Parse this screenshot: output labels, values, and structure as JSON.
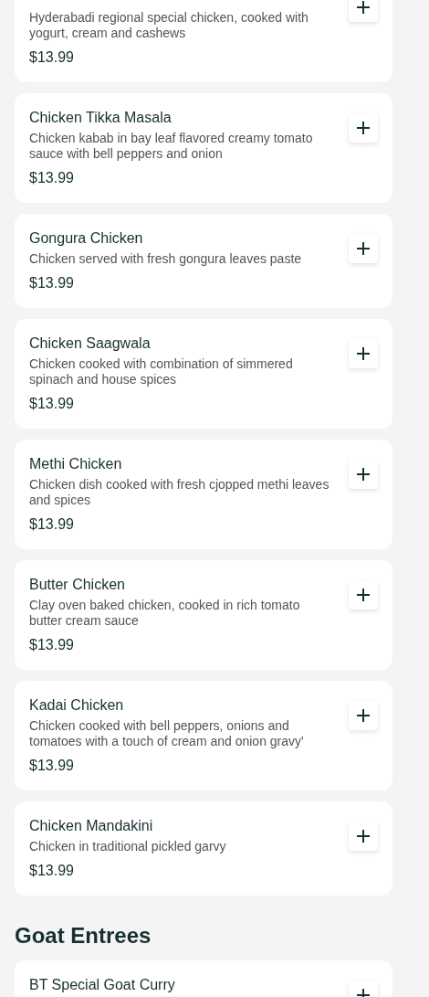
{
  "sections": [
    {
      "items": [
        {
          "description": "Hyderabadi regional special chicken, cooked with yogurt, cream and cashews",
          "price": "$13.99"
        },
        {
          "name": "Chicken Tikka Masala",
          "description": "Chicken kabab in bay leaf flavored creamy tomato sauce with bell peppers and onion",
          "price": "$13.99"
        },
        {
          "name": "Gongura Chicken",
          "description": "Chicken served with fresh gongura leaves paste",
          "price": "$13.99"
        },
        {
          "name": "Chicken Saagwala",
          "description": "Chicken cooked with combination of simmered spinach and house spices",
          "price": "$13.99"
        },
        {
          "name": "Methi Chicken",
          "description": "Chicken dish cooked with fresh cjopped methi leaves and spices",
          "price": "$13.99"
        },
        {
          "name": "Butter Chicken",
          "description": "Clay oven baked chicken, cooked in rich tomato butter cream sauce",
          "price": "$13.99"
        },
        {
          "name": "Kadai Chicken",
          "description": "Chicken cooked with bell peppers, onions and tomatoes with a touch of cream and onion gravy'",
          "price": "$13.99"
        },
        {
          "name": "Chicken Mandakini",
          "description": "Chicken in traditional pickled garvy",
          "price": "$13.99"
        }
      ]
    },
    {
      "heading": "Goat Entrees",
      "items": [
        {
          "name": "BT Special Goat Curry"
        }
      ]
    }
  ]
}
